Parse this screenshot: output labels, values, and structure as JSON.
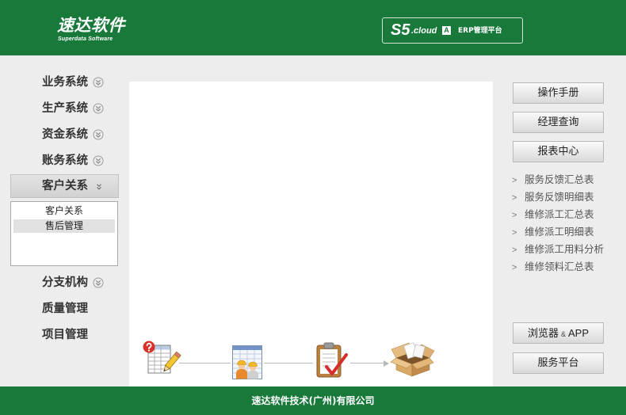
{
  "header": {
    "logo_text": "速达软件",
    "logo_sub": "Superdata Software",
    "product": {
      "name": "S5",
      "suffix": ".cloud",
      "badge": "A",
      "platform": "ERP管理平台"
    }
  },
  "colors": {
    "brand_green": "#18793b",
    "page_background": "#ededed",
    "panel_background": "#ffffff"
  },
  "sidebar": {
    "items": [
      {
        "label": "业务系统",
        "icon": "chevron-circle-down-icon"
      },
      {
        "label": "生产系统",
        "icon": "chevron-circle-down-icon"
      },
      {
        "label": "资金系统",
        "icon": "chevron-circle-down-icon"
      },
      {
        "label": "账务系统",
        "icon": "chevron-circle-down-icon"
      },
      {
        "label": "客户关系",
        "icon": "double-chevron-down-icon",
        "active": true
      },
      {
        "label": "分支机构",
        "icon": "chevron-circle-down-icon"
      },
      {
        "label": "质量管理"
      },
      {
        "label": "项目管理"
      }
    ],
    "submenu": {
      "items": [
        "客户关系",
        "售后管理"
      ],
      "selected_index": 1
    }
  },
  "workflow": {
    "steps": [
      {
        "icon": "form-entry-icon"
      },
      {
        "icon": "staff-dispatch-icon"
      },
      {
        "icon": "checklist-icon"
      },
      {
        "icon": "open-box-icon"
      }
    ]
  },
  "right_panel": {
    "buttons": [
      "操作手册",
      "经理查询",
      "报表中心"
    ],
    "bullet": ">",
    "reports": [
      "服务反馈汇总表",
      "服务反馈明细表",
      "维修派工汇总表",
      "维修派工明细表",
      "维修派工用料分析",
      "维修领料汇总表"
    ],
    "bottom_buttons": [
      {
        "label": "浏览器",
        "amp": "&",
        "suffix": "APP"
      },
      {
        "label": "服务平台"
      }
    ]
  },
  "footer": {
    "company": "速达软件技术(广州)有限公司"
  }
}
